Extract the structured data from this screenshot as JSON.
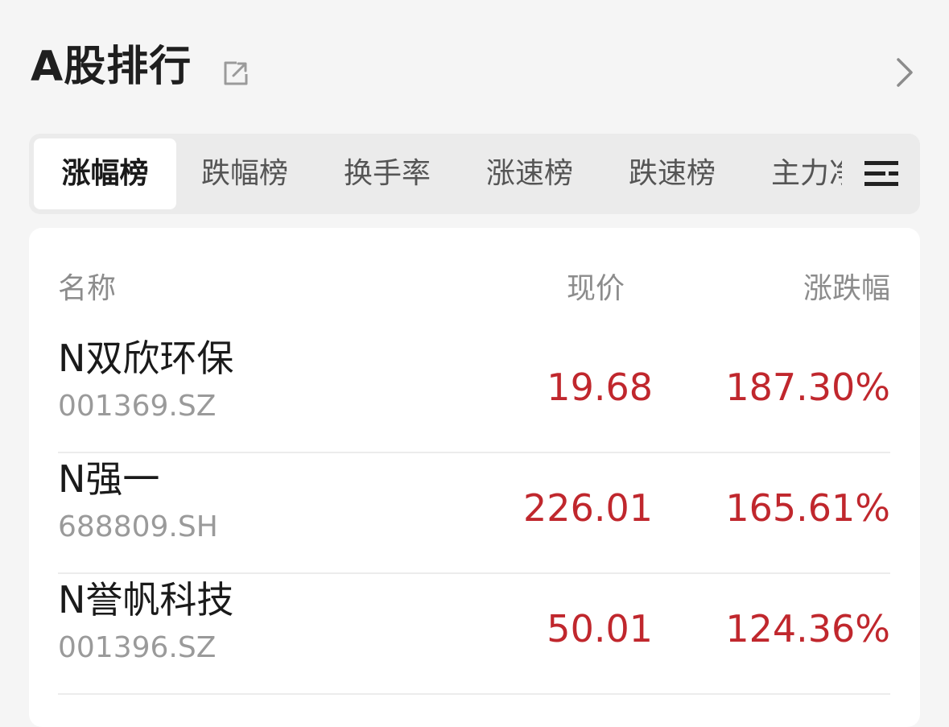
{
  "header": {
    "title": "A股排行"
  },
  "tabs": [
    {
      "label": "涨幅榜",
      "active": true
    },
    {
      "label": "跌幅榜",
      "active": false
    },
    {
      "label": "换手率",
      "active": false
    },
    {
      "label": "涨速榜",
      "active": false
    },
    {
      "label": "跌速榜",
      "active": false
    },
    {
      "label": "主力净",
      "active": false
    }
  ],
  "table": {
    "columns": [
      "名称",
      "现价",
      "涨跌幅"
    ],
    "rows": [
      {
        "name": "N双欣环保",
        "code": "001369.SZ",
        "price": "19.68",
        "change": "187.30%"
      },
      {
        "name": "N强一",
        "code": "688809.SH",
        "price": "226.01",
        "change": "165.61%"
      },
      {
        "name": "N誉帆科技",
        "code": "001396.SZ",
        "price": "50.01",
        "change": "124.36%"
      }
    ]
  },
  "colors": {
    "up": "#c0272d",
    "background": "#f5f5f5",
    "card": "#ffffff"
  },
  "icons": {
    "share": "share-icon",
    "more": "chevron-right-icon",
    "menu": "menu-icon"
  }
}
